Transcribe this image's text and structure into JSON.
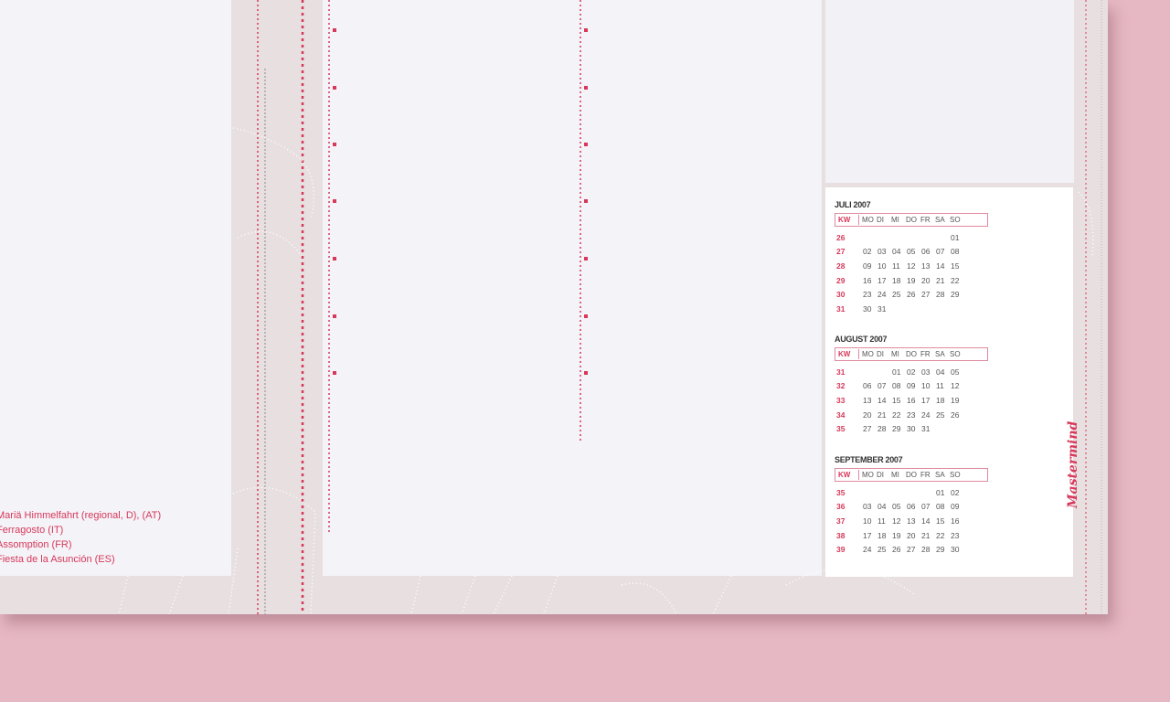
{
  "holidays": [
    "Mariä Himmelfahrt (regional, D), (AT)",
    "Ferragosto (IT)",
    "Assomption (FR)",
    "Fiesta de la Asunción (ES)"
  ],
  "brand": "Mastermind",
  "calendar": {
    "weekday_header": {
      "kw": "KW",
      "days": [
        "MO",
        "DI",
        "MI",
        "DO",
        "FR",
        "SA",
        "SO"
      ]
    },
    "months": [
      {
        "title": "JULI 2007",
        "weeks": [
          {
            "kw": "26",
            "days": [
              "",
              "",
              "",
              "",
              "",
              "",
              "01"
            ]
          },
          {
            "kw": "27",
            "days": [
              "02",
              "03",
              "04",
              "05",
              "06",
              "07",
              "08"
            ]
          },
          {
            "kw": "28",
            "days": [
              "09",
              "10",
              "11",
              "12",
              "13",
              "14",
              "15"
            ]
          },
          {
            "kw": "29",
            "days": [
              "16",
              "17",
              "18",
              "19",
              "20",
              "21",
              "22"
            ]
          },
          {
            "kw": "30",
            "days": [
              "23",
              "24",
              "25",
              "26",
              "27",
              "28",
              "29"
            ]
          },
          {
            "kw": "31",
            "days": [
              "30",
              "31",
              "",
              "",
              "",
              "",
              ""
            ]
          }
        ]
      },
      {
        "title": "AUGUST 2007",
        "weeks": [
          {
            "kw": "31",
            "days": [
              "",
              "",
              "01",
              "02",
              "03",
              "04",
              "05"
            ]
          },
          {
            "kw": "32",
            "days": [
              "06",
              "07",
              "08",
              "09",
              "10",
              "11",
              "12"
            ]
          },
          {
            "kw": "33",
            "days": [
              "13",
              "14",
              "15",
              "16",
              "17",
              "18",
              "19"
            ]
          },
          {
            "kw": "34",
            "days": [
              "20",
              "21",
              "22",
              "23",
              "24",
              "25",
              "26"
            ]
          },
          {
            "kw": "35",
            "days": [
              "27",
              "28",
              "29",
              "30",
              "31",
              "",
              ""
            ]
          }
        ]
      },
      {
        "title": "SEPTEMBER 2007",
        "weeks": [
          {
            "kw": "35",
            "days": [
              "",
              "",
              "",
              "",
              "",
              "01",
              "02"
            ]
          },
          {
            "kw": "36",
            "days": [
              "03",
              "04",
              "05",
              "06",
              "07",
              "08",
              "09"
            ]
          },
          {
            "kw": "37",
            "days": [
              "10",
              "11",
              "12",
              "13",
              "14",
              "15",
              "16"
            ]
          },
          {
            "kw": "38",
            "days": [
              "17",
              "18",
              "19",
              "20",
              "21",
              "22",
              "23"
            ]
          },
          {
            "kw": "39",
            "days": [
              "24",
              "25",
              "26",
              "27",
              "28",
              "29",
              "30"
            ]
          }
        ]
      }
    ]
  },
  "colors": {
    "background": "#e6b8c3",
    "accent": "#d7385a",
    "paper": "#f4f3f8"
  }
}
